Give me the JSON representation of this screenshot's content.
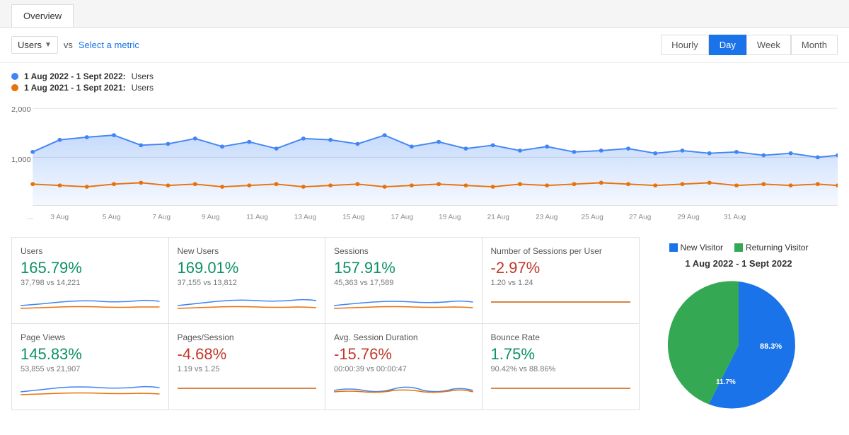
{
  "tab": {
    "label": "Overview"
  },
  "controls": {
    "metric": "Users",
    "vs_text": "vs",
    "select_metric": "Select a metric",
    "time_buttons": [
      "Hourly",
      "Day",
      "Week",
      "Month"
    ],
    "active_time": "Day"
  },
  "legend": {
    "date_range_1": "1 Aug 2022 - 1 Sept 2022:",
    "label_1": "Users",
    "date_range_2": "1 Aug 2021 - 1 Sept 2021:",
    "label_2": "Users"
  },
  "chart": {
    "y_labels": [
      "2,000",
      "1,000"
    ],
    "x_labels": [
      "...",
      "3 Aug",
      "5 Aug",
      "7 Aug",
      "9 Aug",
      "11 Aug",
      "13 Aug",
      "15 Aug",
      "17 Aug",
      "19 Aug",
      "21 Aug",
      "23 Aug",
      "25 Aug",
      "27 Aug",
      "29 Aug",
      "31 Aug"
    ]
  },
  "metrics": [
    {
      "label": "Users",
      "value": "165.79%",
      "color": "green",
      "sub": "37,798 vs 14,221"
    },
    {
      "label": "New Users",
      "value": "169.01%",
      "color": "green",
      "sub": "37,155 vs 13,812"
    },
    {
      "label": "Sessions",
      "value": "157.91%",
      "color": "green",
      "sub": "45,363 vs 17,589"
    },
    {
      "label": "Number of Sessions per User",
      "value": "-2.97%",
      "color": "red",
      "sub": "1.20 vs 1.24"
    },
    {
      "label": "Page Views",
      "value": "145.83%",
      "color": "green",
      "sub": "53,855 vs 21,907"
    },
    {
      "label": "Pages/Session",
      "value": "-4.68%",
      "color": "red",
      "sub": "1.19 vs 1.25"
    },
    {
      "label": "Avg. Session Duration",
      "value": "-15.76%",
      "color": "red",
      "sub": "00:00:39 vs 00:00:47"
    },
    {
      "label": "Bounce Rate",
      "value": "1.75%",
      "color": "green",
      "sub": "90.42% vs 88.86%"
    }
  ],
  "pie": {
    "legend": [
      {
        "label": "New Visitor",
        "color": "blue"
      },
      {
        "label": "Returning Visitor",
        "color": "green"
      }
    ],
    "title": "1 Aug 2022 - 1 Sept 2022",
    "new_pct": "88.3%",
    "returning_pct": "11.7%",
    "new_value": 88.3,
    "returning_value": 11.7
  }
}
